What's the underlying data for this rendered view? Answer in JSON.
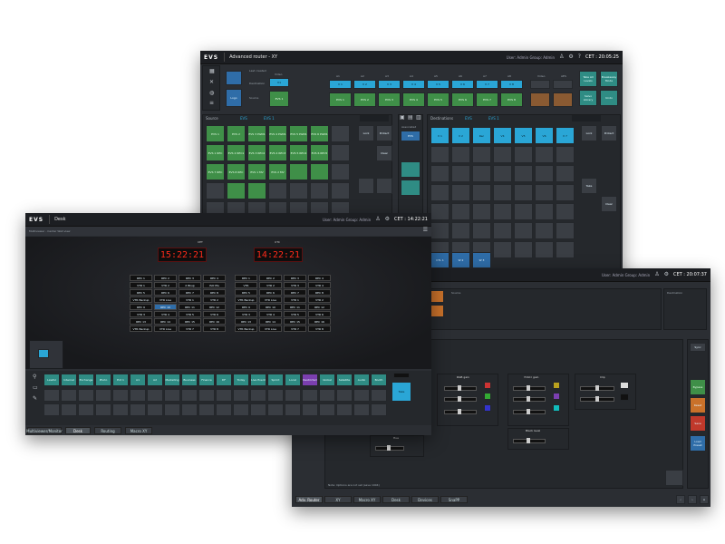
{
  "brand": "EVS",
  "router": {
    "title": "Advanced router - XY",
    "user_info": "User: Admin  Group: Admin",
    "clock": "CET : 20:05:25",
    "source_label": "Source",
    "destination_label": "Destination",
    "dest_header_label": "Destinations",
    "last_saved": "Last created",
    "video_label": "Video",
    "dest_value": "V1",
    "source_value": "EVS 1",
    "prog_label": "Logo",
    "tabs_src": [
      "EVS",
      "EVS 1"
    ],
    "tabs_dst": [
      "EVS",
      "EVS 1"
    ],
    "audio_headers": [
      "A1",
      "A2",
      "A3",
      "A4",
      "A5",
      "A6",
      "A7",
      "A8"
    ],
    "audio_dest": [
      "V 1",
      "V 2",
      "V 3",
      "V 4",
      "V 5",
      "V 6",
      "V 7",
      "V 8"
    ],
    "audio_src": [
      "EVS 1",
      "EVS 2",
      "EVS 3",
      "EVS 4",
      "EVS 5",
      "EVS 6",
      "EVS 7",
      "EVS 8"
    ],
    "extra_headers": [
      "Video",
      "AES"
    ],
    "side_buttons": [
      "Take All Levels",
      "Breakaway Mode",
      "Salvo Library",
      "Undo"
    ],
    "sources": [
      "EVS 1",
      "EVS 2",
      "EVS 3 PGM1",
      "EVS 4 PGM1",
      "EVS 5 PGM1",
      "EVS 6 PGM1",
      "EVS 1 REC",
      "EVS 2 REC1",
      "EVS 3 REC2",
      "EVS 4 REC3",
      "EVS 5 REC4",
      "EVS 6 REC5",
      "EVS 7 REC",
      "EVS 8 REC",
      "EVS 1 MV",
      "EVS 2 MV"
    ],
    "src_actions": [
      "Lock",
      "Protect",
      "Clear"
    ],
    "assoc_label": "Associated",
    "assoc_value": "EVS",
    "dests": [
      "V 1",
      "V 2",
      "Rec",
      "V4",
      "V5",
      "V6",
      "V 7",
      "V 8"
    ],
    "dest_bottom": [
      "CTL 1",
      "W 2",
      "W 3"
    ],
    "dst_actions": [
      "Lock",
      "Protect",
      "Take",
      "Clear"
    ],
    "footer_tabs": []
  },
  "desk": {
    "title": "Desk",
    "user_info": "User: Admin  Group: Admin",
    "clock": "CET : 14:22:21",
    "panel_title": "Multiviewer - Center Wall view",
    "clock1_label": "CET",
    "clock1_value": "15:22:21",
    "clock2_label": "UTC",
    "clock2_value": "14:22:21",
    "mv_rows": [
      [
        "REC 1",
        "REC 2",
        "REC 3",
        "REC 4",
        "REC 1",
        "REC 2",
        "REC 3",
        "REC 4"
      ],
      [
        "VTR 1",
        "VTR 2",
        "X Bkup",
        "ISO Pts",
        "VTR",
        "VTR 2",
        "VTR 3",
        "VTR 4"
      ],
      [
        "REC 5",
        "REC 6",
        "REC 7",
        "REC 8",
        "REC 5",
        "REC 6",
        "REC 7",
        "REC 8"
      ],
      [
        "VTR Backup",
        "VTR Live",
        "VTR 1",
        "VTR 2",
        "VTR Backup",
        "VTR Live",
        "VTR 1",
        "VTR 2"
      ],
      [
        "REC 9",
        "REC 10",
        "REC 11",
        "REC 12",
        "REC 9",
        "REC 10",
        "REC 11",
        "REC 12"
      ],
      [
        "VTR 3",
        "VTR 4",
        "VTR 5",
        "VTR 6",
        "VTR 3",
        "VTR 4",
        "VTR 5",
        "VTR 6"
      ],
      [
        "REC 13",
        "REC 14",
        "REC 15",
        "REC 16",
        "REC 13",
        "REC 14",
        "REC 15",
        "REC 16"
      ],
      [
        "VTR Backup",
        "VTR Live",
        "VTR 7",
        "VTR 8",
        "VTR Backup",
        "VTR Live",
        "VTR 7",
        "VTR 8"
      ]
    ],
    "src_buttons": [
      "Lawful",
      "Internal",
      "Exchange",
      "Photo",
      "Ext 1",
      "A1",
      "A2",
      "Marketing",
      "Business",
      "Finance",
      "DF",
      "Today",
      "Live Event",
      "Sprint",
      "Local",
      "Restricted",
      "Global",
      "Satellite",
      "Audio",
      "Booth"
    ],
    "take_label": "Take",
    "bottom_tabs": [
      "Multiviewer/Monitor",
      "Desk",
      "Routing",
      "Macro XY"
    ]
  },
  "proc": {
    "clock": "CET : 20:07:37",
    "user_info": "User: Admin  Group: Admin",
    "source_label": "Source",
    "destination_label": "Destination",
    "rgb_label": "RGB gain",
    "ycbcr_label": "YCbCr gain",
    "clip_label": "Clip",
    "black_label": "Black level",
    "hue_label": "Hue",
    "note": "Note: Options are not set (save 1904)",
    "reset_label": "Reset",
    "save_label": "Save",
    "bottom_tabs": [
      "Adv. Router",
      "XY",
      "Macro XY",
      "Desk",
      "Devices",
      "SnaPP"
    ],
    "right_labels": [
      "Sync",
      "Bypass",
      "Reset",
      "Save",
      "Load Preset"
    ]
  },
  "colors": {
    "cyan": "#2aa6d6",
    "green": "#3f8f48",
    "clock_red": "#ff2a1a",
    "bg": "#2b2e33"
  }
}
